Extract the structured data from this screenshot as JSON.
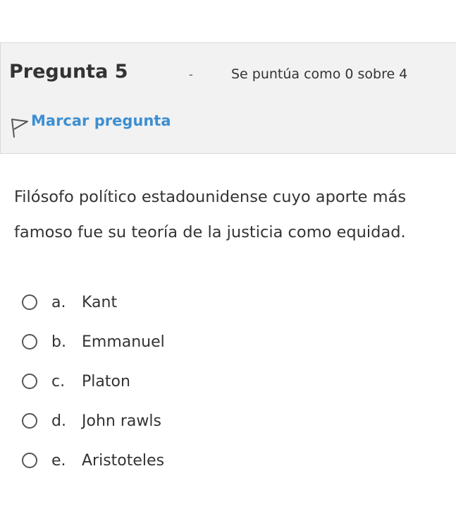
{
  "question": {
    "title": "Pregunta 5",
    "separator": "-",
    "grade": "Se puntúa como 0 sobre 4",
    "flag_label": "Marcar pregunta",
    "text": "Filósofo político estadounidense cuyo aporte más famoso fue su teoría de la justicia como equidad."
  },
  "answers": [
    {
      "letter": "a.",
      "text": "Kant",
      "selected": false
    },
    {
      "letter": "b.",
      "text": "Emmanuel",
      "selected": false
    },
    {
      "letter": "c.",
      "text": "Platon",
      "selected": false
    },
    {
      "letter": "d.",
      "text": "John rawls",
      "selected": false
    },
    {
      "letter": "e.",
      "text": "Aristoteles",
      "selected": false
    }
  ],
  "colors": {
    "link": "#3d8fd1",
    "info_background": "#f2f2f2"
  },
  "icons": {
    "flag": "flag-outline-icon",
    "radio": "radio-unchecked-icon"
  }
}
